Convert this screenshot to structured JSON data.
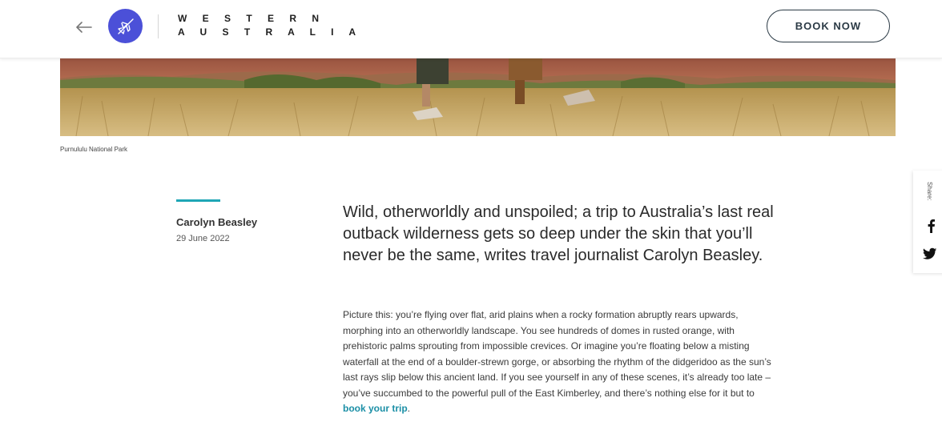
{
  "header": {
    "logo_line1": "W E S T E R N",
    "logo_line2": "A U S T R A L I A",
    "book_label": "BOOK NOW"
  },
  "hero": {
    "caption": "Purnululu National Park"
  },
  "article": {
    "author": "Carolyn Beasley",
    "date": "29 June 2022",
    "lede": "Wild, otherworldly and unspoiled; a trip to Australia’s last real outback wilderness gets so deep under the skin that you’ll never be the same, writes travel journalist Carolyn Beasley.",
    "body_text": "Picture this: you’re flying over flat, arid plains when a rocky formation abruptly rears upwards, morphing into an otherworldly landscape. You see hundreds of domes in rusted orange, with prehistoric palms sprouting from impossible crevices. Or imagine you’re floating below a misting waterfall at the end of a boulder-strewn gorge, or absorbing the rhythm of the didgeridoo as the sun’s last rays slip below this ancient land. If you see yourself in any of these scenes, it’s already too late – you’ve succumbed to the powerful pull of the East Kimberley, and there’s nothing else for it but to ",
    "link_text": "book your trip",
    "body_end": "."
  },
  "share": {
    "label": "Share:",
    "icons": [
      "facebook-icon",
      "twitter-icon"
    ]
  },
  "colors": {
    "brand": "#4b50d8",
    "accent": "#1fa6b6",
    "link": "#1b8fa6"
  }
}
